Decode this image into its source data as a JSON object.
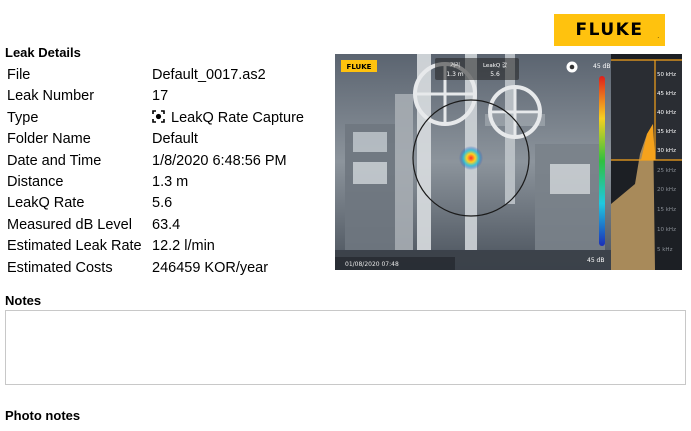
{
  "logo": {
    "text": "FLUKE",
    "mark": "."
  },
  "leak_details": {
    "title": "Leak Details",
    "rows": [
      {
        "label": "File",
        "value": "Default_0017.as2"
      },
      {
        "label": "Leak Number",
        "value": "17"
      },
      {
        "label": "Type",
        "value": "LeakQ Rate Capture",
        "icon": "leakq-capture-icon"
      },
      {
        "label": "Folder Name",
        "value": "Default"
      },
      {
        "label": "Date and Time",
        "value": "1/8/2020 6:48:56 PM"
      },
      {
        "label": "Distance",
        "value": "1.3 m"
      },
      {
        "label": "LeakQ Rate",
        "value": "5.6"
      },
      {
        "label": "Measured dB Level",
        "value": "63.4"
      },
      {
        "label": "Estimated Leak Rate",
        "value": "12.2 l/min"
      },
      {
        "label": "Estimated Costs",
        "value": "246459 KOR/year"
      }
    ]
  },
  "photo": {
    "badge": "FLUKE",
    "distance_label": "거리",
    "distance_value": "1.3 m",
    "leakq_label": "LeakQ 값",
    "leakq_value": "5.6",
    "db_top": "45 dB",
    "db_bottom": "45 dB",
    "timestamp": "01/08/2020 07:48",
    "freq_labels": [
      "50 kHz",
      "45 kHz",
      "40 kHz",
      "35 kHz",
      "30 kHz",
      "25 kHz",
      "20 kHz",
      "15 kHz",
      "10 kHz",
      "5 kHz"
    ],
    "selected_band": "30 kHz – 50 kHz",
    "colors": {
      "accent": "#ffc20e",
      "selected_band": "#f5a21c",
      "spectrum_fill": "#a88a5a"
    }
  },
  "notes": {
    "title": "Notes",
    "text": ""
  },
  "photo_notes": {
    "title": "Photo notes"
  }
}
